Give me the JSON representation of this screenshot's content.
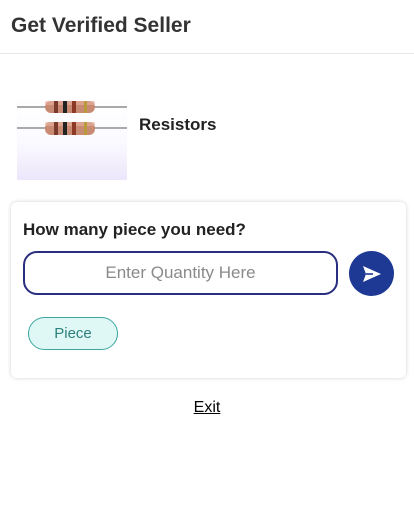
{
  "header": {
    "title": "Get Verified Seller"
  },
  "product": {
    "name": "Resistors",
    "image_icon": "resistor-image"
  },
  "quantity_card": {
    "question": "How many piece you need?",
    "input_placeholder": "Enter Quantity Here",
    "input_value": "",
    "send_icon": "send-arrow-icon",
    "unit_label": "Piece"
  },
  "footer": {
    "exit_label": "Exit"
  },
  "colors": {
    "accent": "#1d3994",
    "input_border": "#2a2e7e",
    "chip_bg": "#dff8f6",
    "chip_border": "#3aa6a0"
  }
}
